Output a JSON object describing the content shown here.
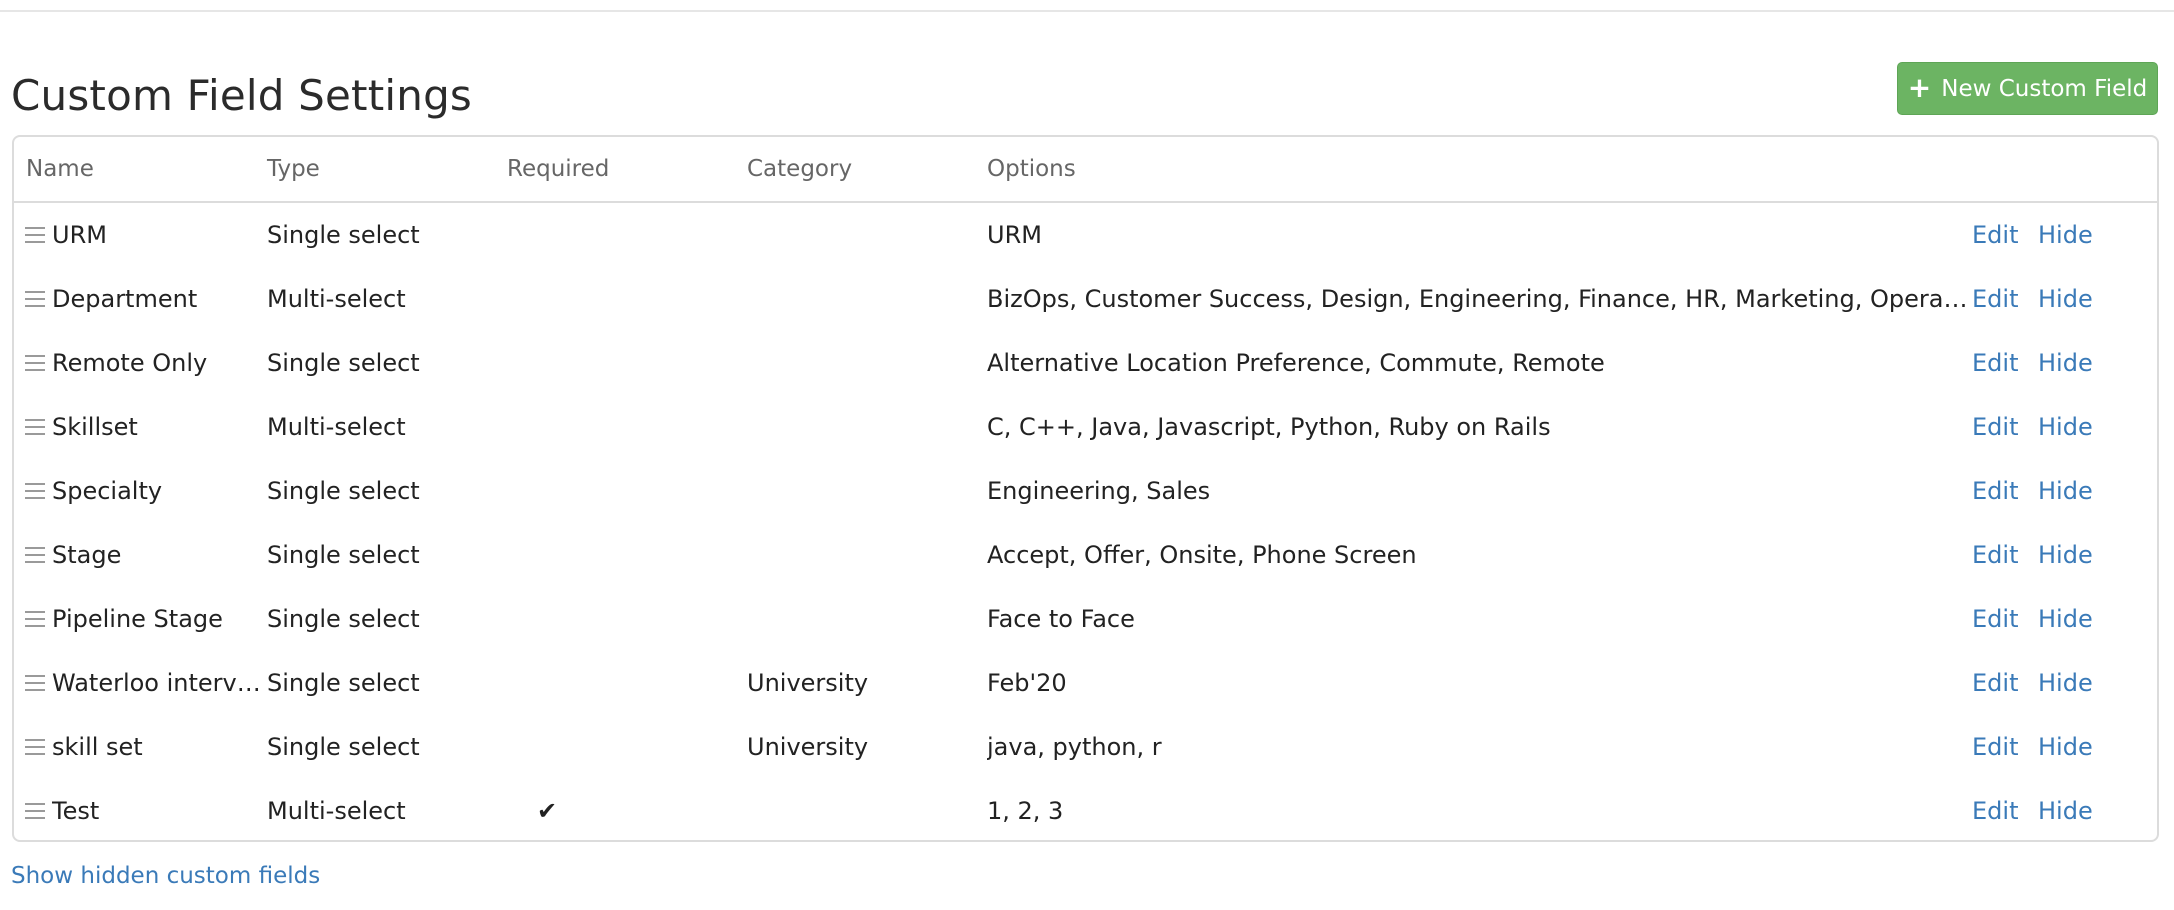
{
  "page": {
    "title": "Custom Field Settings",
    "new_button_label": "New Custom Field",
    "show_hidden_label": "Show hidden custom fields"
  },
  "table": {
    "headers": {
      "name": "Name",
      "type": "Type",
      "required": "Required",
      "category": "Category",
      "options": "Options"
    },
    "actions": {
      "edit": "Edit",
      "hide": "Hide"
    },
    "required_mark": "✔",
    "rows": [
      {
        "name": "URM",
        "type": "Single select",
        "required": false,
        "category": "",
        "options": "URM"
      },
      {
        "name": "Department",
        "type": "Multi-select",
        "required": false,
        "category": "",
        "options": "BizOps, Customer Success, Design, Engineering, Finance, HR, Marketing, Operations, Oth..."
      },
      {
        "name": "Remote Only",
        "type": "Single select",
        "required": false,
        "category": "",
        "options": "Alternative Location Preference, Commute, Remote"
      },
      {
        "name": "Skillset",
        "type": "Multi-select",
        "required": false,
        "category": "",
        "options": "C, C++, Java, Javascript, Python, Ruby on Rails"
      },
      {
        "name": "Specialty",
        "type": "Single select",
        "required": false,
        "category": "",
        "options": "Engineering, Sales"
      },
      {
        "name": "Stage",
        "type": "Single select",
        "required": false,
        "category": "",
        "options": "Accept, Offer, Onsite, Phone Screen"
      },
      {
        "name": "Pipeline Stage",
        "type": "Single select",
        "required": false,
        "category": "",
        "options": "Face to Face"
      },
      {
        "name": "Waterloo intervie...",
        "type": "Single select",
        "required": false,
        "category": "University",
        "options": "Feb'20"
      },
      {
        "name": "skill set",
        "type": "Single select",
        "required": false,
        "category": "University",
        "options": "java, python, r"
      },
      {
        "name": "Test",
        "type": "Multi-select",
        "required": true,
        "category": "",
        "options": "1, 2, 3"
      }
    ]
  },
  "colors": {
    "primary_button": "#6cb463",
    "link": "#3a7ab8",
    "border": "#dcdcdc"
  }
}
